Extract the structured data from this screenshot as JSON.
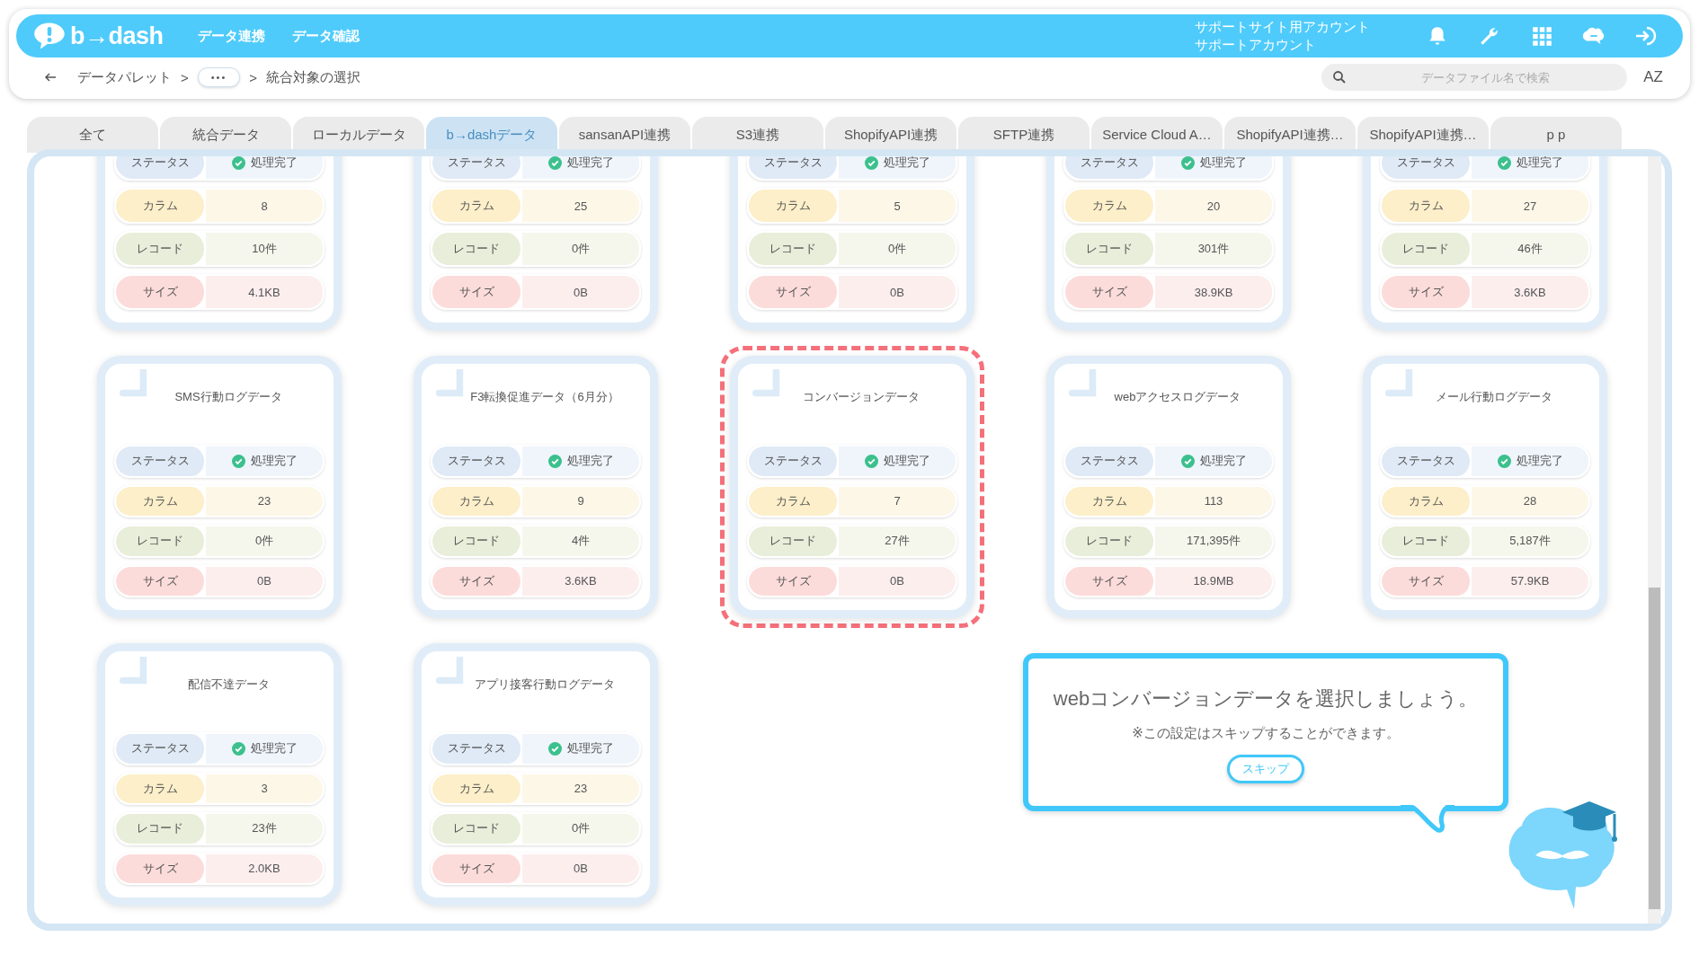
{
  "header": {
    "logo": "b→dash",
    "nav": [
      "データ連携",
      "データ確認"
    ],
    "account": [
      "サポートサイト用アカウント",
      "サポートアカウント"
    ]
  },
  "breadcrumb": {
    "items": [
      {
        "kind": "link",
        "text": "データパレット"
      },
      {
        "kind": "sep",
        "text": ">"
      },
      {
        "kind": "more",
        "text": "•••"
      },
      {
        "kind": "sep",
        "text": ">"
      },
      {
        "kind": "current",
        "text": "統合対象の選択"
      }
    ]
  },
  "search": {
    "placeholder": "データファイル名で検索"
  },
  "sort_button": "AZ",
  "tabs": [
    {
      "label": "全て",
      "selected": false
    },
    {
      "label": "統合データ",
      "selected": false
    },
    {
      "label": "ローカルデータ",
      "selected": false
    },
    {
      "label": "b→dashデータ",
      "selected": true
    },
    {
      "label": "sansanAPI連携",
      "selected": false
    },
    {
      "label": "S3連携",
      "selected": false
    },
    {
      "label": "ShopifyAPI連携",
      "selected": false
    },
    {
      "label": "SFTP連携",
      "selected": false
    },
    {
      "label": "Service Cloud A…",
      "selected": false
    },
    {
      "label": "ShopifyAPI連携…",
      "selected": false
    },
    {
      "label": "ShopifyAPI連携…",
      "selected": false
    },
    {
      "label": "p p",
      "selected": false
    }
  ],
  "cards": [
    {
      "selected": false,
      "rows": [
        {
          "kind": "status",
          "label": "ステータス",
          "value": "処理完了"
        },
        {
          "kind": "columns",
          "label": "カラム",
          "value": "8"
        },
        {
          "kind": "records",
          "label": "レコード",
          "value": "10件"
        },
        {
          "kind": "size",
          "label": "サイズ",
          "value": "4.1KB"
        }
      ]
    },
    {
      "selected": false,
      "rows": [
        {
          "kind": "status",
          "label": "ステータス",
          "value": "処理完了"
        },
        {
          "kind": "columns",
          "label": "カラム",
          "value": "25"
        },
        {
          "kind": "records",
          "label": "レコード",
          "value": "0件"
        },
        {
          "kind": "size",
          "label": "サイズ",
          "value": "0B"
        }
      ]
    },
    {
      "selected": false,
      "rows": [
        {
          "kind": "status",
          "label": "ステータス",
          "value": "処理完了"
        },
        {
          "kind": "columns",
          "label": "カラム",
          "value": "5"
        },
        {
          "kind": "records",
          "label": "レコード",
          "value": "0件"
        },
        {
          "kind": "size",
          "label": "サイズ",
          "value": "0B"
        }
      ]
    },
    {
      "selected": false,
      "rows": [
        {
          "kind": "status",
          "label": "ステータス",
          "value": "処理完了"
        },
        {
          "kind": "columns",
          "label": "カラム",
          "value": "20"
        },
        {
          "kind": "records",
          "label": "レコード",
          "value": "301件"
        },
        {
          "kind": "size",
          "label": "サイズ",
          "value": "38.9KB"
        }
      ]
    },
    {
      "selected": false,
      "rows": [
        {
          "kind": "status",
          "label": "ステータス",
          "value": "処理完了"
        },
        {
          "kind": "columns",
          "label": "カラム",
          "value": "27"
        },
        {
          "kind": "records",
          "label": "レコード",
          "value": "46件"
        },
        {
          "kind": "size",
          "label": "サイズ",
          "value": "3.6KB"
        }
      ]
    },
    {
      "title": "SMS行動ログデータ",
      "selected": false,
      "rows": [
        {
          "kind": "status",
          "label": "ステータス",
          "value": "処理完了"
        },
        {
          "kind": "columns",
          "label": "カラム",
          "value": "23"
        },
        {
          "kind": "records",
          "label": "レコード",
          "value": "0件"
        },
        {
          "kind": "size",
          "label": "サイズ",
          "value": "0B"
        }
      ]
    },
    {
      "title": "F3転換促進データ（6月分）",
      "selected": false,
      "rows": [
        {
          "kind": "status",
          "label": "ステータス",
          "value": "処理完了"
        },
        {
          "kind": "columns",
          "label": "カラム",
          "value": "9"
        },
        {
          "kind": "records",
          "label": "レコード",
          "value": "4件"
        },
        {
          "kind": "size",
          "label": "サイズ",
          "value": "3.6KB"
        }
      ]
    },
    {
      "title": "コンバージョンデータ",
      "selected": true,
      "rows": [
        {
          "kind": "status",
          "label": "ステータス",
          "value": "処理完了"
        },
        {
          "kind": "columns",
          "label": "カラム",
          "value": "7"
        },
        {
          "kind": "records",
          "label": "レコード",
          "value": "27件"
        },
        {
          "kind": "size",
          "label": "サイズ",
          "value": "0B"
        }
      ]
    },
    {
      "title": "webアクセスログデータ",
      "selected": false,
      "rows": [
        {
          "kind": "status",
          "label": "ステータス",
          "value": "処理完了"
        },
        {
          "kind": "columns",
          "label": "カラム",
          "value": "113"
        },
        {
          "kind": "records",
          "label": "レコード",
          "value": "171,395件"
        },
        {
          "kind": "size",
          "label": "サイズ",
          "value": "18.9MB"
        }
      ]
    },
    {
      "title": "メール行動ログデータ",
      "selected": false,
      "rows": [
        {
          "kind": "status",
          "label": "ステータス",
          "value": "処理完了"
        },
        {
          "kind": "columns",
          "label": "カラム",
          "value": "28"
        },
        {
          "kind": "records",
          "label": "レコード",
          "value": "5,187件"
        },
        {
          "kind": "size",
          "label": "サイズ",
          "value": "57.9KB"
        }
      ]
    },
    {
      "title": "配信不達データ",
      "selected": false,
      "rows": [
        {
          "kind": "status",
          "label": "ステータス",
          "value": "処理完了"
        },
        {
          "kind": "columns",
          "label": "カラム",
          "value": "3"
        },
        {
          "kind": "records",
          "label": "レコード",
          "value": "23件"
        },
        {
          "kind": "size",
          "label": "サイズ",
          "value": "2.0KB"
        }
      ]
    },
    {
      "title": "アプリ接客行動ログデータ",
      "selected": false,
      "rows": [
        {
          "kind": "status",
          "label": "ステータス",
          "value": "処理完了"
        },
        {
          "kind": "columns",
          "label": "カラム",
          "value": "23"
        },
        {
          "kind": "records",
          "label": "レコード",
          "value": "0件"
        },
        {
          "kind": "size",
          "label": "サイズ",
          "value": "0B"
        }
      ]
    }
  ],
  "guide": {
    "message": "webコンバージョンデータを選択しましょう。",
    "note": "※この設定はスキップすることができます。",
    "button": "スキップ"
  }
}
